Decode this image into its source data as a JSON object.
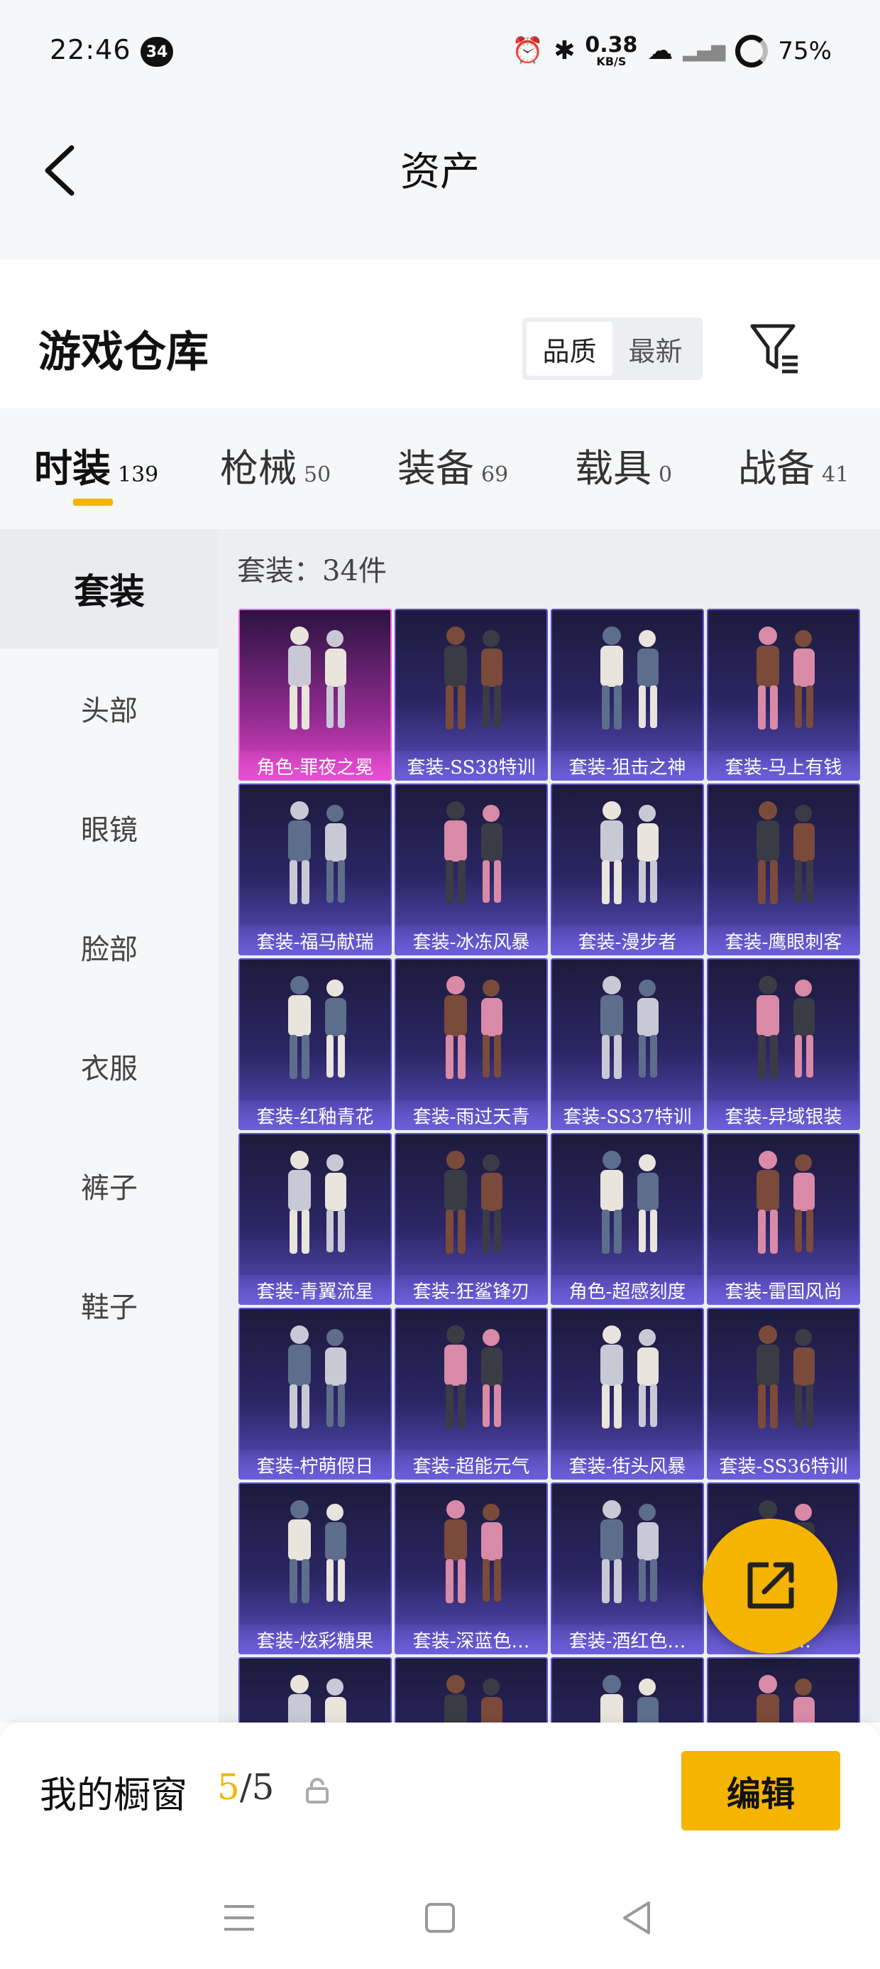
{
  "status_bar": {
    "time": "22:46",
    "badge": "34",
    "net_speed": "0.38",
    "net_unit": "KB/S",
    "battery": "75%"
  },
  "header": {
    "title": "资产"
  },
  "warehouse": {
    "title": "游戏仓库",
    "sort_options": [
      "品质",
      "最新"
    ],
    "active_sort": 0
  },
  "tabs": [
    {
      "label": "时装",
      "count": "139"
    },
    {
      "label": "枪械",
      "count": "50"
    },
    {
      "label": "装备",
      "count": "69"
    },
    {
      "label": "载具",
      "count": "0"
    },
    {
      "label": "战备",
      "count": "41"
    }
  ],
  "sidebar": {
    "items": [
      "套装",
      "头部",
      "眼镜",
      "脸部",
      "衣服",
      "裤子",
      "鞋子"
    ]
  },
  "content": {
    "count_label": "套装：34件",
    "items": [
      {
        "label": "角色-罪夜之冕",
        "rarity": "pink"
      },
      {
        "label": "套装-SS38特训",
        "rarity": "purple"
      },
      {
        "label": "套装-狙击之神",
        "rarity": "purple"
      },
      {
        "label": "套装-马上有钱",
        "rarity": "purple"
      },
      {
        "label": "套装-福马献瑞",
        "rarity": "purple"
      },
      {
        "label": "套装-冰冻风暴",
        "rarity": "purple"
      },
      {
        "label": "套装-漫步者",
        "rarity": "purple"
      },
      {
        "label": "套装-鹰眼刺客",
        "rarity": "purple"
      },
      {
        "label": "套装-红釉青花",
        "rarity": "purple"
      },
      {
        "label": "套装-雨过天青",
        "rarity": "purple"
      },
      {
        "label": "套装-SS37特训",
        "rarity": "purple"
      },
      {
        "label": "套装-异域银装",
        "rarity": "purple"
      },
      {
        "label": "套装-青翼流星",
        "rarity": "purple"
      },
      {
        "label": "套装-狂鲨锋刃",
        "rarity": "purple"
      },
      {
        "label": "角色-超感刻度",
        "rarity": "purple"
      },
      {
        "label": "套装-雷国风尚",
        "rarity": "purple"
      },
      {
        "label": "套装-柠萌假日",
        "rarity": "purple"
      },
      {
        "label": "套装-超能元气",
        "rarity": "purple"
      },
      {
        "label": "套装-街头风暴",
        "rarity": "purple"
      },
      {
        "label": "套装-SS36特训",
        "rarity": "purple"
      },
      {
        "label": "套装-炫彩糖果",
        "rarity": "purple"
      },
      {
        "label": "套装-深蓝色…",
        "rarity": "purple"
      },
      {
        "label": "套装-酒红色…",
        "rarity": "purple"
      },
      {
        "label": "…色…",
        "rarity": "purple"
      },
      {
        "label": "",
        "rarity": "purple"
      },
      {
        "label": "",
        "rarity": "purple"
      },
      {
        "label": "",
        "rarity": "purple"
      },
      {
        "label": "",
        "rarity": "purple"
      }
    ]
  },
  "bottom": {
    "showcase_label": "我的橱窗",
    "showcase_current": "5",
    "showcase_total": "/5",
    "edit_label": "编辑"
  },
  "colors": {
    "accent": "#f5b400",
    "card_purple": "#2b2664",
    "card_pink": "#e044c9"
  },
  "icons": {
    "back": "chevron-left-icon",
    "filter": "filter-icon",
    "share": "share-external-icon",
    "lock": "lock-icon"
  }
}
